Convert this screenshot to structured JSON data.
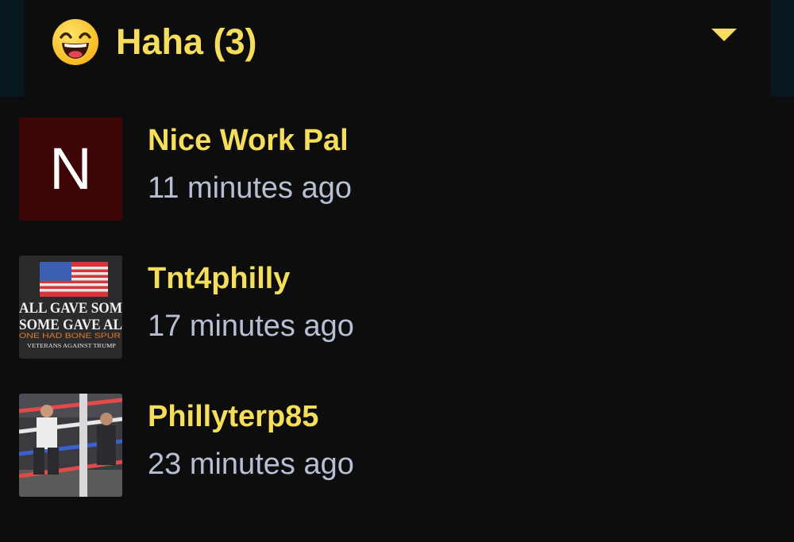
{
  "reactions_panel": {
    "header": {
      "emoji": "grinning-face-icon",
      "title": "Haha (3)",
      "toggle_icon": "caret-down-icon"
    },
    "users": [
      {
        "name": "Nice Work Pal",
        "time": "11 minutes ago",
        "avatar": {
          "type": "letter",
          "letter": "N",
          "bg_color": "#3d0505"
        }
      },
      {
        "name": "Tnt4philly",
        "time": "17 minutes ago",
        "avatar": {
          "type": "image",
          "image_text": [
            "ALL GAVE SOM",
            "SOME GAVE AL",
            "ONE HAD BONE SPUR",
            "VETERANS AGAINST TRUMP"
          ]
        }
      },
      {
        "name": "Phillyterp85",
        "time": "23 minutes ago",
        "avatar": {
          "type": "image"
        }
      }
    ]
  },
  "colors": {
    "accent": "#f4de5c",
    "secondary_text": "#b6bfd3",
    "background": "#0d0d0e",
    "edge": "#06171d"
  }
}
